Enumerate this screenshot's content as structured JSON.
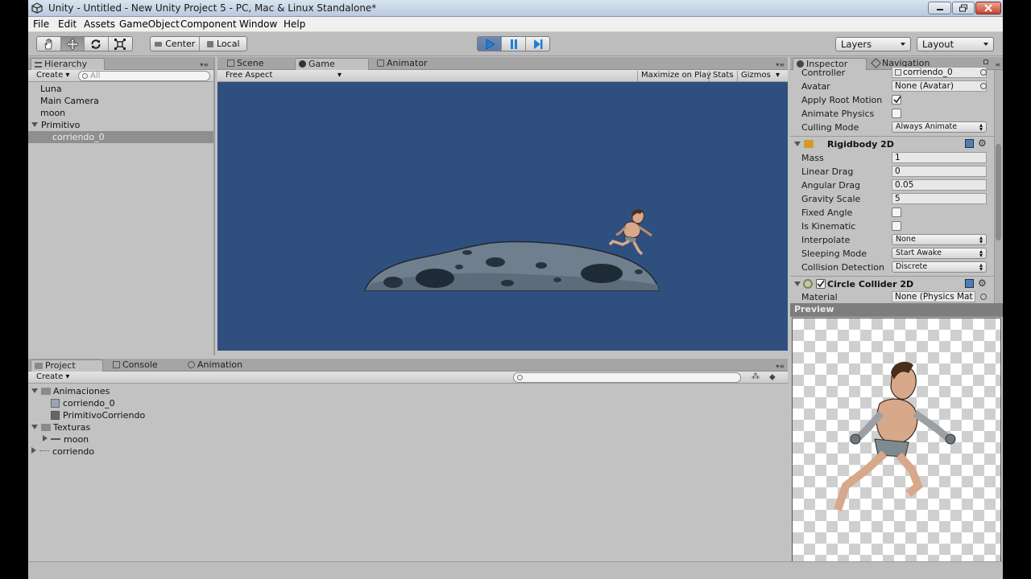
{
  "window": {
    "title": "Unity - Untitled - New Unity Project 5 - PC, Mac & Linux Standalone*"
  },
  "menu": [
    "File",
    "Edit",
    "Assets",
    "GameObject",
    "Component",
    "Window",
    "Help"
  ],
  "toolbar": {
    "transform_tools": [
      "hand-tool",
      "move-tool",
      "rotate-tool",
      "scale-tool"
    ],
    "pivot_label": "Center",
    "space_label": "Local",
    "play_controls": [
      "play",
      "pause",
      "step"
    ],
    "layers_label": "Layers",
    "layout_label": "Layout"
  },
  "hierarchy": {
    "tab": "Hierarchy",
    "create_label": "Create",
    "search_placeholder": "All",
    "items": [
      {
        "label": "Luna",
        "depth": 0
      },
      {
        "label": "Main Camera",
        "depth": 0
      },
      {
        "label": "moon",
        "depth": 0
      },
      {
        "label": "Primitivo",
        "depth": 0,
        "expanded": true
      },
      {
        "label": "corriendo_0",
        "depth": 1,
        "selected": true
      }
    ]
  },
  "center": {
    "tabs": [
      "Scene",
      "Game",
      "Animator"
    ],
    "active_tab": "Game",
    "aspect_label": "Free Aspect",
    "maximize_label": "Maximize on Play",
    "stats_label": "Stats",
    "gizmos_label": "Gizmos",
    "game_bg_color": "#2f4f7f"
  },
  "project": {
    "tabs": [
      "Project",
      "Console",
      "Animation"
    ],
    "create_label": "Create",
    "items": [
      {
        "label": "Animaciones",
        "depth": 0,
        "type": "folder",
        "expanded": true
      },
      {
        "label": "corriendo_0",
        "depth": 1,
        "type": "animator-controller"
      },
      {
        "label": "PrimitivoCorriendo",
        "depth": 1,
        "type": "animation-clip"
      },
      {
        "label": "Texturas",
        "depth": 0,
        "type": "folder",
        "expanded": true
      },
      {
        "label": "moon",
        "depth": 1,
        "type": "texture"
      },
      {
        "label": "corriendo",
        "depth": 0,
        "type": "texture"
      }
    ]
  },
  "inspector": {
    "tabs": [
      "Inspector",
      "Navigation"
    ],
    "animator": {
      "controller_label": "Controller",
      "controller_value": "corriendo_0",
      "avatar_label": "Avatar",
      "avatar_value": "None (Avatar)",
      "apply_root_motion_label": "Apply Root Motion",
      "apply_root_motion": true,
      "animate_physics_label": "Animate Physics",
      "animate_physics": false,
      "culling_mode_label": "Culling Mode",
      "culling_mode_value": "Always Animate"
    },
    "rigidbody": {
      "title": "Rigidbody 2D",
      "mass_label": "Mass",
      "mass": "1",
      "linear_drag_label": "Linear Drag",
      "linear_drag": "0",
      "angular_drag_label": "Angular Drag",
      "angular_drag": "0.05",
      "gravity_scale_label": "Gravity Scale",
      "gravity_scale": "5",
      "fixed_angle_label": "Fixed Angle",
      "fixed_angle": false,
      "is_kinematic_label": "Is Kinematic",
      "is_kinematic": false,
      "interpolate_label": "Interpolate",
      "interpolate": "None",
      "sleeping_mode_label": "Sleeping Mode",
      "sleeping_mode": "Start Awake",
      "collision_detection_label": "Collision Detection",
      "collision_detection": "Discrete"
    },
    "circle_collider": {
      "title": "Circle Collider 2D",
      "enabled": true,
      "material_label": "Material",
      "material_value": "None (Physics Mat"
    },
    "preview_label": "Preview"
  }
}
